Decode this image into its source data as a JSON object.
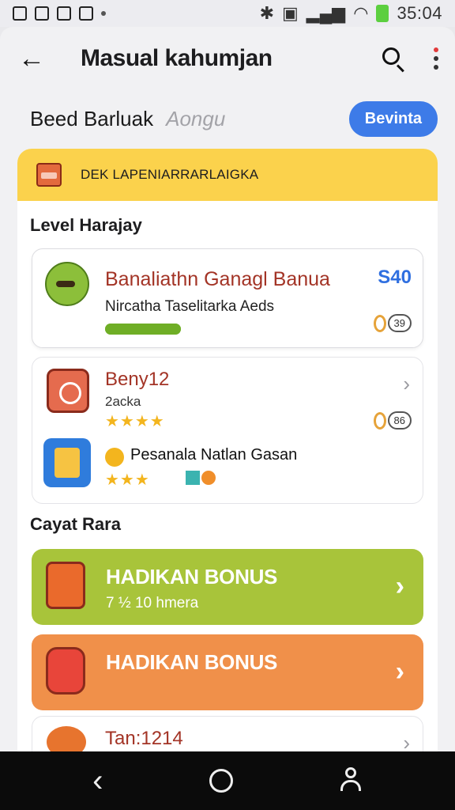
{
  "status": {
    "time": "35:04",
    "battery_color": "#5ccf3f"
  },
  "appbar": {
    "title": "Masual kahumjan",
    "back_icon": "arrow-left-icon",
    "search_icon": "search-icon",
    "menu_icon": "kebab-menu-icon"
  },
  "filter": {
    "label": "Beed Barluak",
    "sub": "Aongu",
    "button": "Bevinta",
    "button_color": "#3d7be8"
  },
  "banner": {
    "text": "DEK LAPENIARRARLAIGKA",
    "color": "#fbd24c"
  },
  "sections": {
    "level_title": "Level Harajay",
    "cayat_title": "Cayat Rara"
  },
  "items": [
    {
      "title": "Banaliathn Ganagl Banua",
      "subtitle": "Nircatha Taselitarka Aeds",
      "badge": "S40",
      "pill": "39",
      "progress_percent": 100
    },
    {
      "title": "Beny12",
      "subtitle": "2acka",
      "stars": 4,
      "stars_text": "★★★★",
      "pill": "86"
    },
    {
      "title": "Pesanala Natlan Gasan",
      "stars": 3,
      "stars_text": "★★★"
    }
  ],
  "bonuses": [
    {
      "title": "HADIKAN BONUS",
      "sub": "7 ½ 10 hmera",
      "color": "#a8c43a"
    },
    {
      "title": "HADIKAN BONUS",
      "sub": "",
      "color": "#f0904a"
    }
  ],
  "item3": {
    "title": "Tan:1214"
  },
  "navbar": {
    "back_icon": "nav-back-icon",
    "home_icon": "nav-home-icon",
    "profile_icon": "nav-profile-icon"
  }
}
